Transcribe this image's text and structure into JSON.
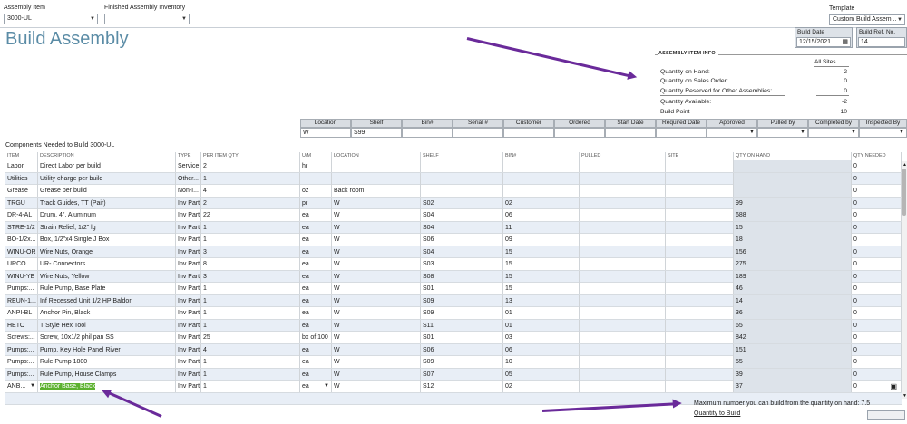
{
  "top": {
    "assembly_item_label": "Assembly Item",
    "assembly_item_value": "3000-UL",
    "finished_inventory_label": "Finished Assembly Inventory",
    "finished_inventory_value": "",
    "template_label": "Template",
    "template_value": "Custom Build Assem..."
  },
  "page_title": "Build Assembly",
  "build": {
    "date_label": "Build Date",
    "date_value": "12/15/2021",
    "ref_label": "Build Ref. No.",
    "ref_value": "14"
  },
  "info": {
    "title": "ASSEMBLY ITEM INFO",
    "all_sites": "All Sites",
    "rows": [
      {
        "label": "Quantity on Hand:",
        "value": "-2"
      },
      {
        "label": "Quantity on Sales Order:",
        "value": "0"
      },
      {
        "label": "Quantity Reserved for Other Assemblies:",
        "value": "0"
      },
      {
        "label": "Quantity Available:",
        "value": "-2"
      },
      {
        "label": "Build Point",
        "value": "10"
      }
    ]
  },
  "fields": {
    "headers": [
      "Location",
      "Shelf",
      "Bin#",
      "Serial #",
      "Customer",
      "Ordered",
      "Start Date",
      "Required Date",
      "Approved",
      "Pulled by",
      "Completed by",
      "Inspected By"
    ],
    "values": [
      "W",
      "S99",
      "",
      "",
      "",
      "",
      "",
      "",
      "",
      "",
      "",
      ""
    ]
  },
  "components_label": "Components Needed to Build  3000-UL",
  "grid": {
    "columns": [
      "ITEM",
      "DESCRIPTION",
      "TYPE",
      "PER ITEM QTY",
      "U/M",
      "LOCATION",
      "SHELF",
      "BIN#",
      "PULLED",
      "SITE",
      "QTY ON HAND",
      "QTY NEEDED"
    ],
    "rows": [
      [
        "Labor",
        "Direct Labor per build",
        "Service",
        "2",
        "hr",
        "",
        "",
        "",
        "",
        "",
        "",
        "0"
      ],
      [
        "Utilities",
        "Utility charge per build",
        "Other...",
        "1",
        "",
        "",
        "",
        "",
        "",
        "",
        "",
        "0"
      ],
      [
        "Grease",
        "Grease per build",
        "Non-I...",
        "4",
        "oz",
        "Back room",
        "",
        "",
        "",
        "",
        "",
        "0"
      ],
      [
        "TRGU",
        "Track Guides, TT (Pair)",
        "Inv Part",
        "2",
        "pr",
        "W",
        "S02",
        "02",
        "",
        "",
        "99",
        "0"
      ],
      [
        "DR-4-AL",
        "Drum, 4\", Aluminum",
        "Inv Part",
        "22",
        "ea",
        "W",
        "S04",
        "06",
        "",
        "",
        "688",
        "0"
      ],
      [
        "STRE-1/2",
        "Strain Relief, 1/2\" lg",
        "Inv Part",
        "1",
        "ea",
        "W",
        "S04",
        "11",
        "",
        "",
        "15",
        "0"
      ],
      [
        "BO-1/2x...",
        "Box, 1/2\"x4 Single J Box",
        "Inv Part",
        "1",
        "ea",
        "W",
        "S06",
        "09",
        "",
        "",
        "18",
        "0"
      ],
      [
        "WINU-OR",
        "Wire Nuts, Orange",
        "Inv Part",
        "3",
        "ea",
        "W",
        "S04",
        "15",
        "",
        "",
        "156",
        "0"
      ],
      [
        "URCO",
        "UR- Connectors",
        "Inv Part",
        "8",
        "ea",
        "W",
        "S03",
        "15",
        "",
        "",
        "275",
        "0"
      ],
      [
        "WINU-YE",
        "Wire Nuts, Yellow",
        "Inv Part",
        "3",
        "ea",
        "W",
        "S08",
        "15",
        "",
        "",
        "189",
        "0"
      ],
      [
        "Pumps:...",
        "Rule Pump, Base Plate",
        "Inv Part",
        "1",
        "ea",
        "W",
        "S01",
        "15",
        "",
        "",
        "46",
        "0"
      ],
      [
        "REUN-1...",
        "Inf Recessed Unit 1/2 HP Baldor",
        "Inv Part",
        "1",
        "ea",
        "W",
        "S09",
        "13",
        "",
        "",
        "14",
        "0"
      ],
      [
        "ANPI-BL",
        "Anchor Pin, Black",
        "Inv Part",
        "1",
        "ea",
        "W",
        "S09",
        "01",
        "",
        "",
        "36",
        "0"
      ],
      [
        "HETO",
        "T Style Hex Tool",
        "Inv Part",
        "1",
        "ea",
        "W",
        "S11",
        "01",
        "",
        "",
        "65",
        "0"
      ],
      [
        "Screws:...",
        "Screw, 10x1/2 phil pan SS",
        "Inv Part",
        "25",
        "bx of 100",
        "W",
        "S01",
        "03",
        "",
        "",
        "842",
        "0"
      ],
      [
        "Pumps:...",
        "Pump, Key Hole Panel River",
        "Inv Part",
        "4",
        "ea",
        "W",
        "S06",
        "06",
        "",
        "",
        "151",
        "0"
      ],
      [
        "Pumps:...",
        "Rule Pump 1800",
        "Inv Part",
        "1",
        "ea",
        "W",
        "S09",
        "10",
        "",
        "",
        "55",
        "0"
      ],
      [
        "Pumps:...",
        "Rule Pump, House Clamps",
        "Inv Part",
        "1",
        "ea",
        "W",
        "S07",
        "05",
        "",
        "",
        "39",
        "0"
      ],
      [
        "ANB...",
        "Anchor Base, Black",
        "Inv Part",
        "1",
        "ea",
        "W",
        "S12",
        "02",
        "",
        "",
        "37",
        "0"
      ]
    ]
  },
  "footer": {
    "max_build_text": "Maximum number you can build from the quantity on hand: 7.5",
    "qty_to_build_label": "Quantity to Build",
    "qty_to_build_value": ""
  },
  "colors": {
    "title": "#5b8ca6",
    "arrow": "#6a2a9a",
    "row_alt": "#e8eef6",
    "selected": "#5cb12e"
  }
}
